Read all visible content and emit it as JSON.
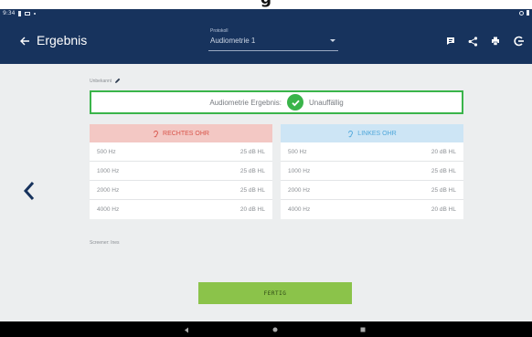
{
  "caption": "g",
  "status_bar": {
    "time": "9:34",
    "left_icons": [
      "sim-icon",
      "mail-icon",
      "dot-icon"
    ],
    "right_icons": [
      "wifi-icon",
      "battery-icon"
    ]
  },
  "app_bar": {
    "title": "Ergebnis",
    "protocol_label": "Protokoll",
    "protocol_value": "Audiometrie 1",
    "actions": [
      "message-icon",
      "share-icon",
      "print-icon",
      "logout-icon"
    ]
  },
  "result": {
    "unknown_label": "Unbekannt",
    "label": "Audiometrie Ergebnis:",
    "value": "Unauffällig",
    "status_color": "#3ab44a"
  },
  "right_ear": {
    "title": "RECHTES OHR",
    "color": "#d8544a",
    "rows": [
      {
        "frequency": "500 Hz",
        "level": "25 dB HL"
      },
      {
        "frequency": "1000 Hz",
        "level": "25 dB HL"
      },
      {
        "frequency": "2000 Hz",
        "level": "25 dB HL"
      },
      {
        "frequency": "4000 Hz",
        "level": "20 dB HL"
      }
    ]
  },
  "left_ear": {
    "title": "LINKES OHR",
    "color": "#4fa7db",
    "rows": [
      {
        "frequency": "500 Hz",
        "level": "20 dB HL"
      },
      {
        "frequency": "1000 Hz",
        "level": "25 dB HL"
      },
      {
        "frequency": "2000 Hz",
        "level": "25 dB HL"
      },
      {
        "frequency": "4000 Hz",
        "level": "20 dB HL"
      }
    ]
  },
  "screener": "Screener: Ines",
  "finish_button": "FERTIG",
  "colors": {
    "app_bar": "#17335d",
    "background": "#eceeef",
    "finish": "#8bc34a"
  }
}
